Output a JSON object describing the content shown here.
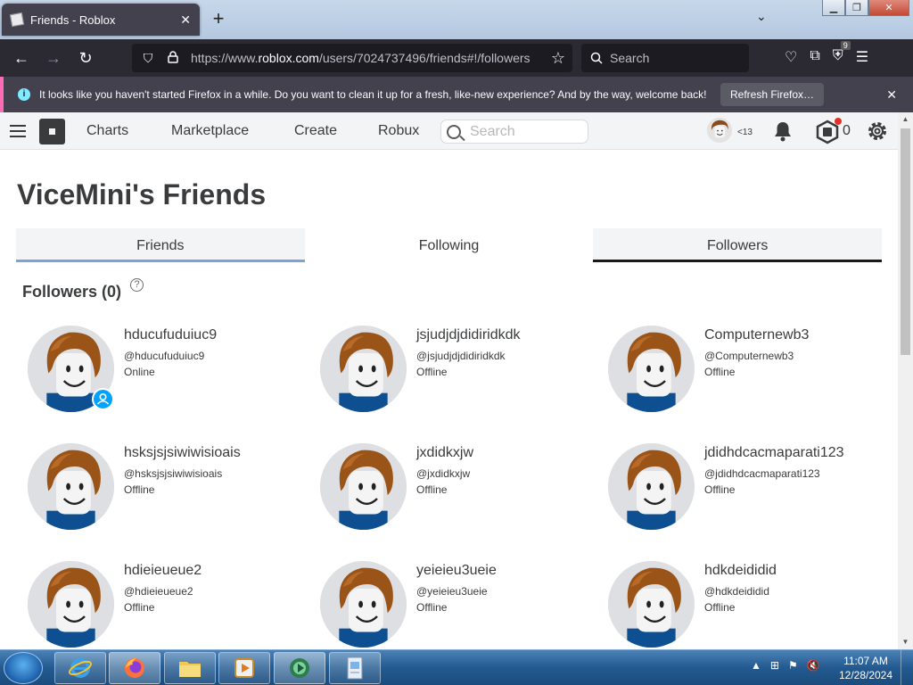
{
  "browser": {
    "tab_title": "Friends - Roblox",
    "url_plain": "https://www.",
    "url_domain": "roblox.com",
    "url_path": "/users/7024737496/friends#!/followers",
    "search_placeholder": "Search",
    "extension_badge": "9",
    "notice_text": "It looks like you haven't started Firefox in a while. Do you want to clean it up for a fresh, like-new experience? And by the way, welcome back!",
    "refresh_label": "Refresh Firefox…"
  },
  "header": {
    "nav": [
      "Charts",
      "Marketplace",
      "Create",
      "Robux"
    ],
    "search_placeholder": "Search",
    "age_label": "<13",
    "robux_count": "0"
  },
  "page": {
    "title": "ViceMini's Friends",
    "tabs": [
      "Friends",
      "Following",
      "Followers"
    ],
    "active_tab": "Followers",
    "section_title": "Followers (0)",
    "help_glyph": "?"
  },
  "users": [
    {
      "name": "hducufuduiuc9",
      "handle": "@hducufuduiuc9",
      "status": "Online"
    },
    {
      "name": "jsjudjdjdidiridkdk",
      "handle": "@jsjudjdjdidiridkdk",
      "status": "Offline"
    },
    {
      "name": "Computernewb3",
      "handle": "@Computernewb3",
      "status": "Offline"
    },
    {
      "name": "hsksjsjsiwiwisioais",
      "handle": "@hsksjsjsiwiwisioais",
      "status": "Offline"
    },
    {
      "name": "jxdidkxjw",
      "handle": "@jxdidkxjw",
      "status": "Offline"
    },
    {
      "name": "jdidhdcacmaparati123",
      "handle": "@jdidhdcacmaparati123",
      "status": "Offline"
    },
    {
      "name": "hdieieueue2",
      "handle": "@hdieieueue2",
      "status": "Offline"
    },
    {
      "name": "yeieieu3ueie",
      "handle": "@yeieieu3ueie",
      "status": "Offline"
    },
    {
      "name": "hdkdeididid",
      "handle": "@hdkdeididid",
      "status": "Offline"
    }
  ],
  "taskbar": {
    "time": "11:07 AM",
    "date": "12/28/2024"
  },
  "colors": {
    "online_presence": "#00a2ff",
    "friends_tab_underline": "#7ea2d6",
    "active_tab_underline": "#191919",
    "notice_accent": "#ff6bb5"
  }
}
